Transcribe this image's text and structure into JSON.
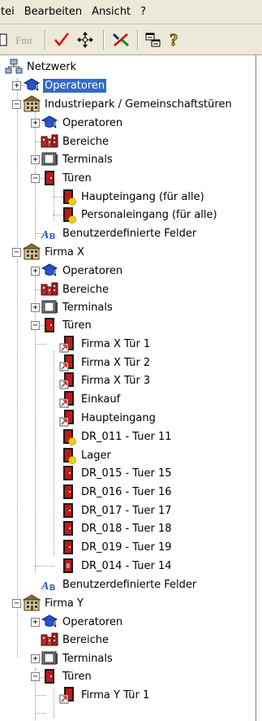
{
  "menu": {
    "items": [
      "tei",
      "Bearbeiten",
      "Ansicht",
      "?"
    ]
  },
  "toolbar": {
    "icons": [
      "new-icon",
      "format-icon",
      "checkmark-icon",
      "move-icon",
      "disconnect-icon",
      "window-icon",
      "help-icon"
    ],
    "format_label": "Fmt"
  },
  "tree": {
    "root": "Netzwerk",
    "operatoren_root": "Operatoren",
    "industriepark": {
      "label": "Industriepark / Gemeinschaftstüren",
      "operatoren": "Operatoren",
      "bereiche": "Bereiche",
      "terminals": "Terminals",
      "tueren": "Türen",
      "doors": [
        "Haupteingang (für alle)",
        "Personaleingang (für alle)"
      ],
      "felder": "Benutzerdefinierte Felder"
    },
    "firma_x": {
      "label": "Firma X",
      "operatoren": "Operatoren",
      "bereiche": "Bereiche",
      "terminals": "Terminals",
      "tueren": "Türen",
      "doors": [
        "Firma X Tür 1",
        "Firma X Tür 2",
        "Firma X Tür 3",
        "Einkauf",
        "Haupteingang",
        "DR_011 - Tuer 11",
        "Lager",
        "DR_015 - Tuer 15",
        "DR_016 - Tuer 16",
        "DR_017 - Tuer 17",
        "DR_018 - Tuer 18",
        "DR_019 - Tuer 19",
        "DR_014 - Tuer 14"
      ],
      "felder": "Benutzerdefinierte Felder"
    },
    "firma_y": {
      "label": "Firma Y",
      "operatoren": "Operatoren",
      "bereiche": "Bereiche",
      "terminals": "Terminals",
      "tueren": "Türen",
      "doors": [
        "Firma Y Tür 1"
      ]
    }
  }
}
